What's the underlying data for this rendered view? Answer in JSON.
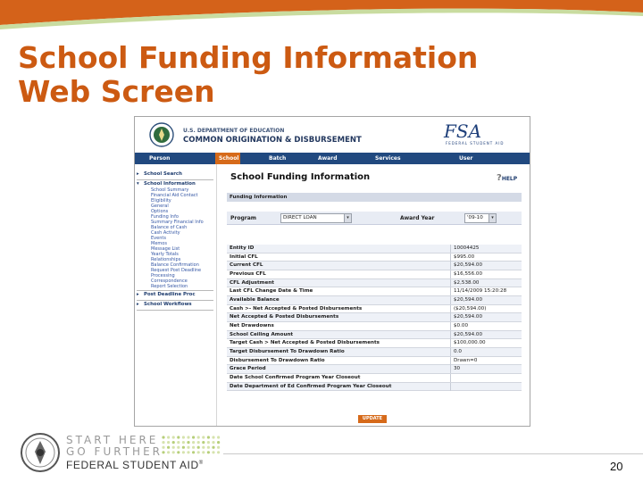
{
  "slide": {
    "title_line1": "School Funding Information",
    "title_line2": "Web Screen",
    "page_number": "20",
    "colors": {
      "title": "#cc5a12",
      "band_orange": "#d4621a",
      "band_light": "#c9dca0"
    },
    "logo": {
      "line1": "START HERE",
      "line2": "GO FURTHER",
      "line3": "FEDERAL STUDENT AID",
      "trademark": "®"
    }
  },
  "app": {
    "agency_line": "U.S. DEPARTMENT OF EDUCATION",
    "product": "COMMON ORIGINATION & DISBURSEMENT",
    "fsa_logo": "FSA",
    "fsa_logo_sub": "FEDERAL STUDENT AID",
    "nav": [
      {
        "label": "Person",
        "active": false
      },
      {
        "label": "School",
        "active": true
      },
      {
        "label": "Batch",
        "active": false
      },
      {
        "label": "Award",
        "active": false
      },
      {
        "label": "Services",
        "active": false
      },
      {
        "label": "User",
        "active": false
      }
    ],
    "sidebar": {
      "school_search": "School Search",
      "school_information": "School Information",
      "sub_items": [
        "School Summary",
        "Financial Aid Contact",
        "Eligibility",
        "General",
        "Options",
        "Funding Info",
        "Summary Financial Info",
        "Balance of Cash",
        "Cash Activity",
        "Events",
        "Memos",
        "Message List",
        "Yearly Totals",
        "Relationships",
        "Balance Confirmation",
        "Request Post Deadline",
        "Processing",
        "Correspondence",
        "Report Selection"
      ],
      "post_deadline": "Post Deadline Proc",
      "workflows": "School Workflows"
    },
    "main": {
      "page_title": "School Funding Information",
      "help": "HELP",
      "help_glyph": "?",
      "section": "Funding Information",
      "program_label": "Program",
      "program_value": "DIRECT LOAN",
      "award_year_label": "Award Year",
      "award_year_value": "'09-10",
      "dropdown_glyph": "▾",
      "rows": [
        {
          "label": "Entity ID",
          "value": "10004425"
        },
        {
          "label": "Initial CFL",
          "value": "$995.00"
        },
        {
          "label": "Current CFL",
          "value": "$20,594.00"
        },
        {
          "label": "Previous CFL",
          "value": "$16,556.00"
        },
        {
          "label": "CFL Adjustment",
          "value": "$2,538.00"
        },
        {
          "label": "Last CFL Change Date & Time",
          "value": "11/14/2009 15:20:28"
        },
        {
          "label": "Available Balance",
          "value": "$20,594.00"
        },
        {
          "label": "Cash >- Net Accepted & Posted Disbursements",
          "value": "($20,594.00)"
        },
        {
          "label": "Net Accepted & Posted Disbursements",
          "value": "$20,594.00"
        },
        {
          "label": "Net Drawdowns",
          "value": "$0.00"
        },
        {
          "label": "School Ceiling Amount",
          "value": "$20,594.00"
        },
        {
          "label": "Target Cash > Net Accepted & Posted Disbursements",
          "value": "$100,000.00"
        },
        {
          "label": "Target Disbursement To Drawdown Ratio",
          "value": "0.0"
        },
        {
          "label": "Disbursement To Drawdown Ratio",
          "value": "Drawn=0"
        },
        {
          "label": "Grace Period",
          "value": "30"
        },
        {
          "label": "Date School Confirmed Program Year Closeout",
          "value": ""
        },
        {
          "label": "Date Department of Ed Confirmed Program Year Closeout",
          "value": ""
        }
      ],
      "update_button": "UPDATE"
    }
  }
}
